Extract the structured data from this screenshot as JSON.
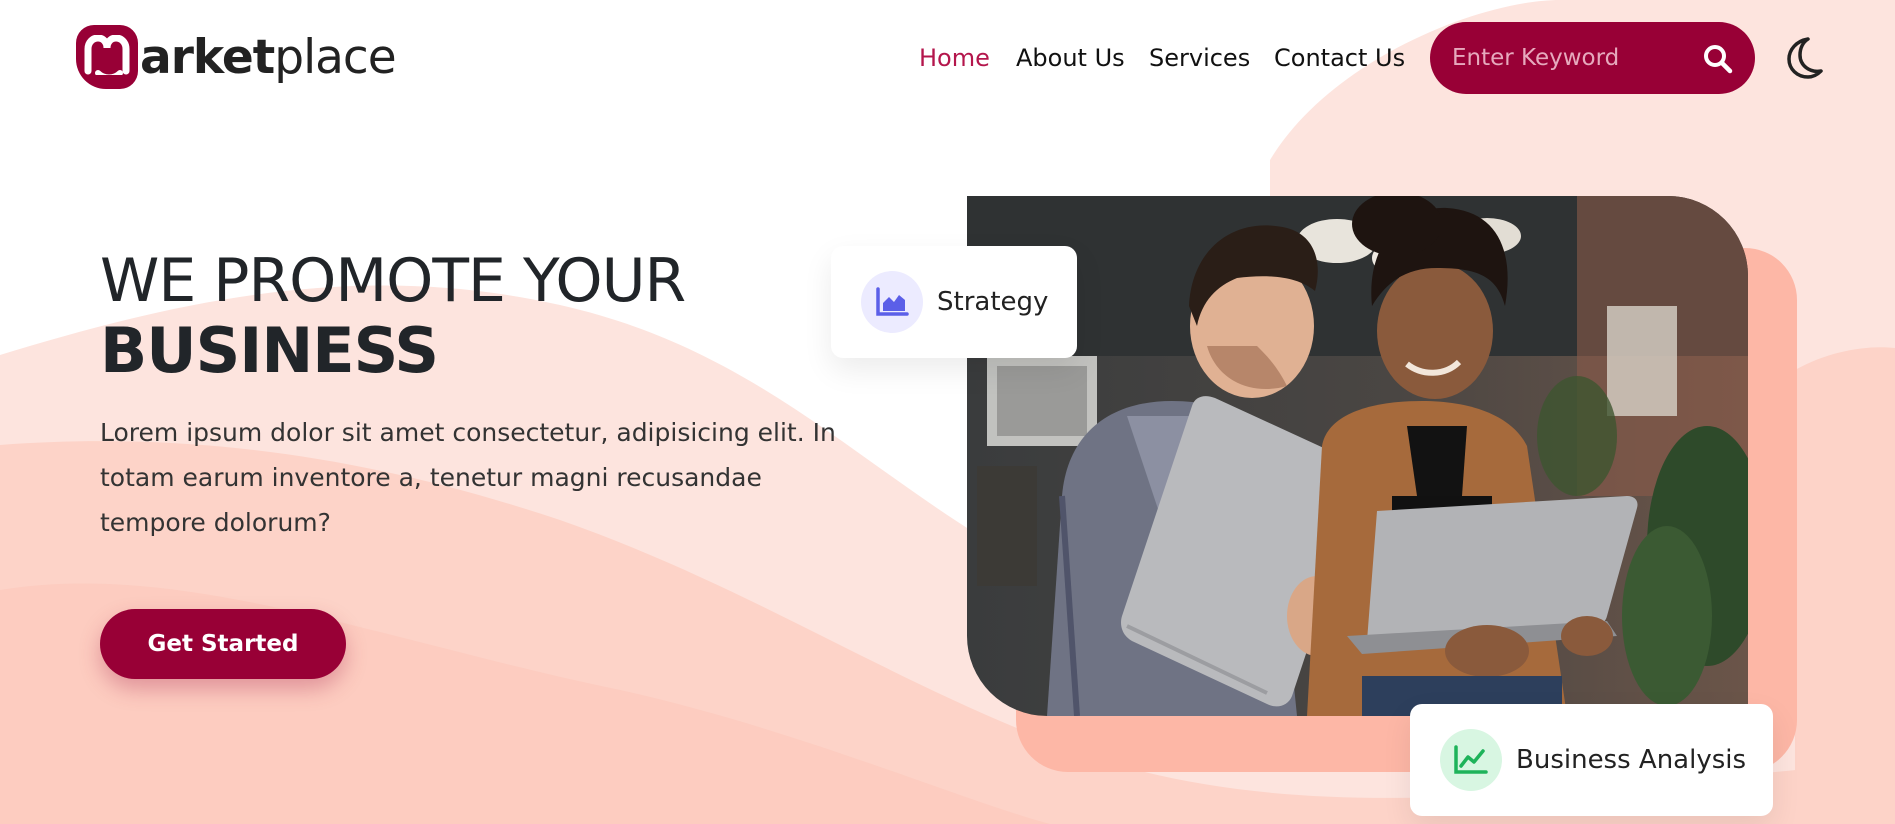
{
  "brand": {
    "name_bold": "arket",
    "name_light": "place",
    "color": "#980036"
  },
  "nav": {
    "items": [
      {
        "label": "Home",
        "active": true
      },
      {
        "label": "About Us",
        "active": false
      },
      {
        "label": "Services",
        "active": false
      },
      {
        "label": "Contact Us",
        "active": false
      }
    ],
    "active_color": "#b4164c"
  },
  "search": {
    "placeholder": "Enter Keyword",
    "icon": "search-icon"
  },
  "theme_toggle": {
    "icon": "moon-icon"
  },
  "hero": {
    "title_light": "WE PROMOTE YOUR",
    "title_bold": "BUSINESS",
    "description": "Lorem ipsum dolor sit amet consectetur, adipisicing elit. In totam earum inventore a, tenetur magni recusandae tempore dolorum?",
    "cta_label": "Get Started"
  },
  "cards": [
    {
      "label": "Strategy",
      "icon": "area-chart-icon",
      "icon_color": "#5b5fe8",
      "icon_bg": "#ecebff"
    },
    {
      "label": "Business Analysis",
      "icon": "line-chart-icon",
      "icon_color": "#1eb35a",
      "icon_bg": "#d8f6e2"
    }
  ],
  "colors": {
    "primary": "#980036",
    "wave_light": "#fde4de",
    "wave_mid": "#fdd3c8",
    "accent_box": "#fdb7a6"
  }
}
